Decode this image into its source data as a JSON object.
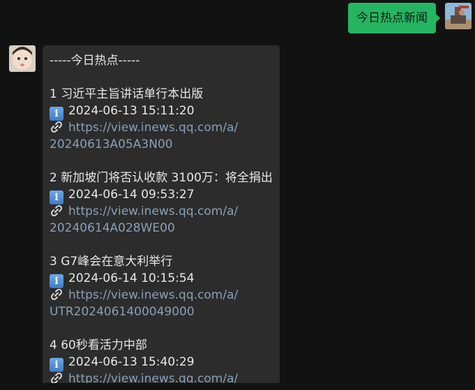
{
  "outgoing": {
    "text": "今日热点新闻"
  },
  "incoming": {
    "header": "-----今日热点-----",
    "items": [
      {
        "title": "1 习近平主旨讲话单行本出版",
        "time": "2024-06-13 15:11:20",
        "link_line1": "https://view.inews.qq.com/a/",
        "link_line2": "20240613A05A3N00"
      },
      {
        "title": "2 新加坡门将否认收款 3100万：将全捐出",
        "time": "2024-06-14 09:53:27",
        "link_line1": "https://view.inews.qq.com/a/",
        "link_line2": "20240614A028WE00"
      },
      {
        "title": "3 G7峰会在意大利举行",
        "time": "2024-06-14 10:15:54",
        "link_line1": "https://view.inews.qq.com/a/",
        "link_line2": "UTR2024061400049000"
      },
      {
        "title": "4 60秒看活力中部",
        "time": "2024-06-13 15:40:29",
        "link_line1": "https://view.inews.qq.com/a/",
        "link_line2": ""
      }
    ]
  },
  "icons": {
    "info": "info-icon",
    "link": "link-icon"
  },
  "colors": {
    "background": "#121212",
    "outgoing_bubble": "#25b562",
    "incoming_bubble": "#2c2c2c",
    "link": "#8aa0b6"
  }
}
